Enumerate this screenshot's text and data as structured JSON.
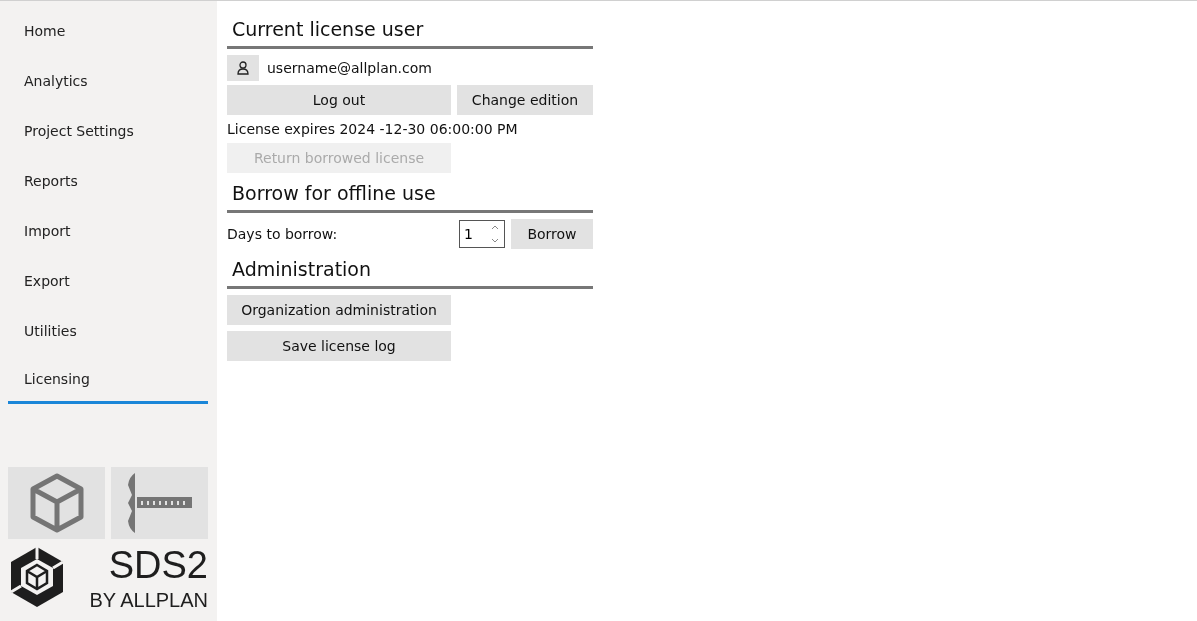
{
  "sidebar": {
    "items": [
      {
        "label": "Home",
        "selected": false
      },
      {
        "label": "Analytics",
        "selected": false
      },
      {
        "label": "Project Settings",
        "selected": false
      },
      {
        "label": "Reports",
        "selected": false
      },
      {
        "label": "Import",
        "selected": false
      },
      {
        "label": "Export",
        "selected": false
      },
      {
        "label": "Utilities",
        "selected": false
      },
      {
        "label": "Licensing",
        "selected": true
      }
    ],
    "logo": {
      "name": "SDS2",
      "tagline": "BY ALLPLAN"
    }
  },
  "current_license_user": {
    "heading": "Current license user",
    "user": "username@allplan.com",
    "buttons": [
      {
        "label": "Log out",
        "disabled": false
      },
      {
        "label": "Change edition",
        "disabled": false
      }
    ],
    "expiry": "License expires 2024 -12-30 06:00:00 PM",
    "return_button": {
      "label": "Return borrowed license",
      "disabled": true
    }
  },
  "borrow": {
    "heading": "Borrow for offline use",
    "label": "Days to borrow:",
    "days": "1",
    "button": "Borrow"
  },
  "administration": {
    "heading": "Administration",
    "buttons": [
      {
        "label": "Organization administration",
        "disabled": false
      },
      {
        "label": "Save license log",
        "disabled": false
      }
    ]
  }
}
